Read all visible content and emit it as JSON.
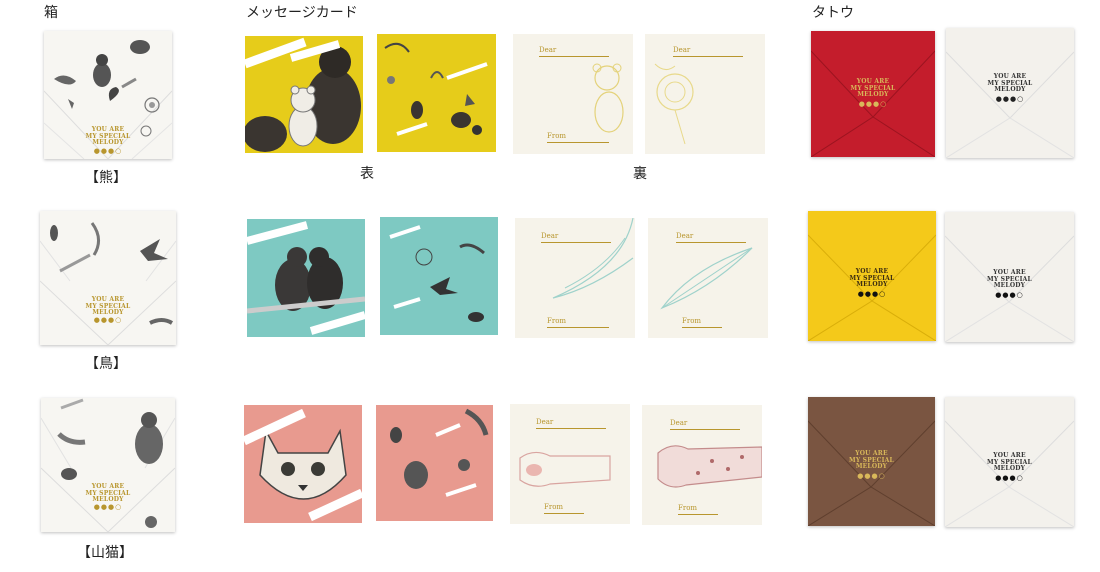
{
  "headers": {
    "box": "箱",
    "message_card": "メッセージカード",
    "tatou": "タトウ"
  },
  "captions": {
    "front": "表",
    "back": "裏"
  },
  "rows": [
    {
      "label": "【熊】",
      "theme": "bear",
      "card_front_color": "#e6cc1a",
      "tatou_color": "#c41d2c"
    },
    {
      "label": "【鳥】",
      "theme": "bird",
      "card_front_color": "#7ec9c2",
      "tatou_color": "#f4c91a"
    },
    {
      "label": "【山猫】",
      "theme": "wildcat",
      "card_front_color": "#e89a8f",
      "tatou_color": "#7a5541"
    }
  ],
  "emblem_lines": [
    "YOU ARE",
    "MY SPECIAL",
    "MELODY"
  ],
  "dots": {
    "bear": "●●●○",
    "bird": "●●●○",
    "wildcat": "●●●○"
  },
  "card_labels": {
    "dear": "Dear",
    "from": "From"
  },
  "ribbon_text": {
    "special": "SPECIAL",
    "melody": "MELODY",
    "you_are": "YOU ARE",
    "you_are_my": "YOU ARE MY"
  },
  "colors": {
    "gold": "#b8962e",
    "box_white": "#f7f6f2",
    "card_back": "#f6f3ea",
    "tatou_white": "#f3f1ec"
  }
}
